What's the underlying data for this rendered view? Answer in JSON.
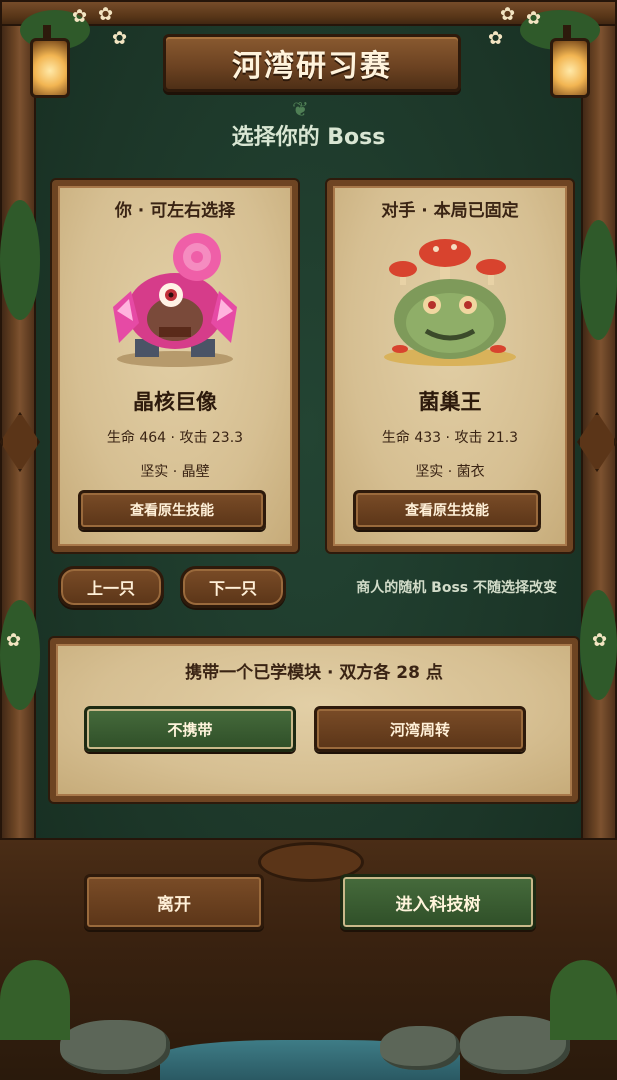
{
  "title": "河湾研习赛",
  "subtitle": "选择你的 Boss",
  "player_card": {
    "header": "你 · 可左右选择",
    "boss_name": "晶核巨像",
    "stats": "生命 464 · 攻击 23.3",
    "traits": "坚实 · 晶壁",
    "skill_button": "查看原生技能"
  },
  "opponent_card": {
    "header": "对手 · 本局已固定",
    "boss_name": "菌巢王",
    "stats": "生命 433 · 攻击 21.3",
    "traits": "坚实 · 菌衣",
    "skill_button": "查看原生技能"
  },
  "nav": {
    "prev": "上一只",
    "next": "下一只",
    "note": "商人的随机 Boss 不随选择改变"
  },
  "module": {
    "title": "携带一个已学模块 · 双方各 28 点",
    "options": [
      "不携带",
      "河湾周转"
    ],
    "selected": "不携带"
  },
  "footer": {
    "leave": "离开",
    "enter": "进入科技树"
  },
  "colors": {
    "wood": "#6e4422",
    "parchment": "#d6bf92",
    "green_button": "#3a5c30",
    "panel_green": "#1c3628"
  }
}
